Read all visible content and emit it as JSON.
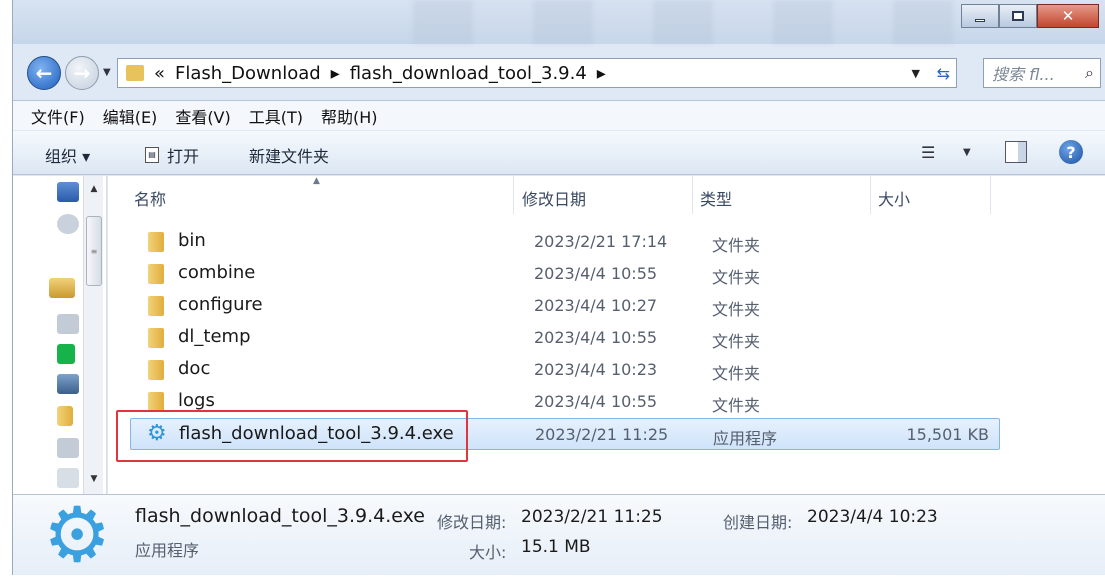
{
  "window": {
    "minimize_label": "—",
    "maximize_label": "☐",
    "close_label": "✕"
  },
  "address": {
    "overflow": "«",
    "path": [
      "Flash_Download",
      "flash_download_tool_3.9.4"
    ],
    "separator": "▸",
    "search_placeholder": "搜索 fl..."
  },
  "menu": [
    "文件(F)",
    "编辑(E)",
    "查看(V)",
    "工具(T)",
    "帮助(H)"
  ],
  "toolbar": {
    "organize_label": "组织 ▾",
    "open_label": "打开",
    "new_folder_label": "新建文件夹"
  },
  "columns": {
    "name": "名称",
    "date": "修改日期",
    "type": "类型",
    "size": "大小"
  },
  "files": [
    {
      "name": "bin",
      "date": "2023/2/21 17:14",
      "type": "文件夹",
      "size": ""
    },
    {
      "name": "combine",
      "date": "2023/4/4 10:55",
      "type": "文件夹",
      "size": ""
    },
    {
      "name": "configure",
      "date": "2023/4/4 10:27",
      "type": "文件夹",
      "size": ""
    },
    {
      "name": "dl_temp",
      "date": "2023/4/4 10:55",
      "type": "文件夹",
      "size": ""
    },
    {
      "name": "doc",
      "date": "2023/4/4 10:23",
      "type": "文件夹",
      "size": ""
    },
    {
      "name": "logs",
      "date": "2023/4/4 10:55",
      "type": "文件夹",
      "size": ""
    },
    {
      "name": "flash_download_tool_3.9.4.exe",
      "date": "2023/2/21 11:25",
      "type": "应用程序",
      "size": "15,501 KB"
    }
  ],
  "details": {
    "name": "flash_download_tool_3.9.4.exe",
    "type": "应用程序",
    "modified_label": "修改日期:",
    "modified_value": "2023/2/21 11:25",
    "created_label": "创建日期:",
    "created_value": "2023/4/4 10:23",
    "size_label": "大小:",
    "size_value": "15.1 MB"
  },
  "colors": {
    "highlight_border": "#e0353f",
    "selection": "#cfe3fa",
    "gear": "#2f95d8"
  }
}
